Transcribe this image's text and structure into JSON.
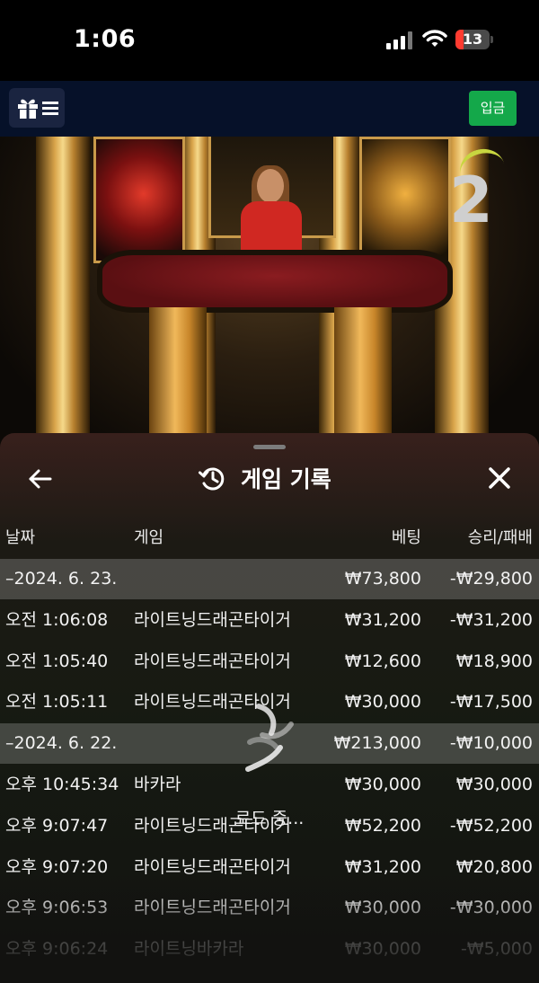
{
  "status_bar": {
    "time": "1:06",
    "battery_level": "13",
    "battery_color": "#ff3b30"
  },
  "top_nav": {
    "menu_icon": "gift-menu-icon",
    "deposit_label": "입금",
    "deposit_color": "#14a84a"
  },
  "video": {
    "round_number": "2"
  },
  "history": {
    "title": "게임 기록",
    "title_icon": "history-icon",
    "back_icon": "arrow-left-icon",
    "close_icon": "close-icon",
    "columns": {
      "date": "날짜",
      "game": "게임",
      "bet": "베팅",
      "win_loss": "승리/패배"
    },
    "rows": [
      {
        "type": "date",
        "date": "–2024. 6. 23.",
        "game": "",
        "bet": "₩73,800",
        "win_loss": "-₩29,800"
      },
      {
        "type": "entry",
        "date": "오전 1:06:08",
        "game": "라이트닝드래곤타이거",
        "bet": "₩31,200",
        "win_loss": "-₩31,200"
      },
      {
        "type": "entry",
        "date": "오전 1:05:40",
        "game": "라이트닝드래곤타이거",
        "bet": "₩12,600",
        "win_loss": "₩18,900"
      },
      {
        "type": "entry",
        "date": "오전 1:05:11",
        "game": "라이트닝드래곤타이거",
        "bet": "₩30,000",
        "win_loss": "-₩17,500"
      },
      {
        "type": "date",
        "date": "–2024. 6. 22.",
        "game": "",
        "bet": "₩213,000",
        "win_loss": "-₩10,000"
      },
      {
        "type": "entry",
        "date": "오후 10:45:34",
        "game": "바카라",
        "bet": "₩30,000",
        "win_loss": "₩30,000"
      },
      {
        "type": "entry",
        "date": "오후 9:07:47",
        "game": "라이트닝드래곤타이거",
        "bet": "₩52,200",
        "win_loss": "-₩52,200"
      },
      {
        "type": "entry",
        "date": "오후 9:07:20",
        "game": "라이트닝드래곤타이거",
        "bet": "₩31,200",
        "win_loss": "₩20,800"
      },
      {
        "type": "entry",
        "date": "오후 9:06:53",
        "game": "라이트닝드래곤타이거",
        "bet": "₩30,000",
        "win_loss": "-₩30,000"
      },
      {
        "type": "entry",
        "date": "오후 9:06:24",
        "game": "라이트닝바카라",
        "bet": "₩30,000",
        "win_loss": "-₩5,000"
      }
    ],
    "loading_text": "로드 중..."
  }
}
